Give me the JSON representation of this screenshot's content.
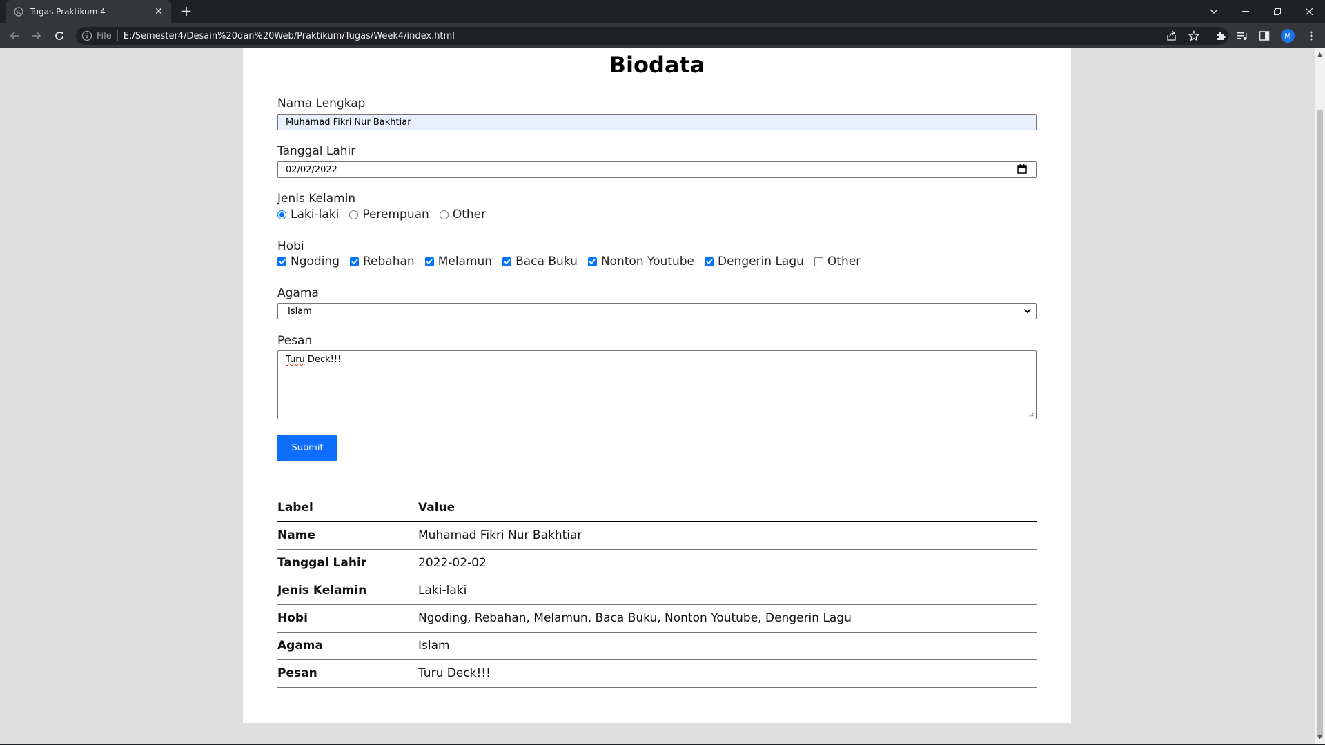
{
  "browser": {
    "tab_title": "Tugas Praktikum 4",
    "scheme": "File",
    "url": "E:/Semester4/Desain%20dan%20Web/Praktikum/Tugas/Week4/index.html",
    "profile_initial": "M"
  },
  "page": {
    "title": "Biodata",
    "form": {
      "nama_label": "Nama Lengkap",
      "nama_value": "Muhamad Fikri Nur Bakhtiar",
      "tanggal_label": "Tanggal Lahir",
      "tanggal_value": "02/02/2022",
      "gender_label": "Jenis Kelamin",
      "gender_options": [
        {
          "label": "Laki-laki",
          "checked": true
        },
        {
          "label": "Perempuan",
          "checked": false
        },
        {
          "label": "Other",
          "checked": false
        }
      ],
      "hobi_label": "Hobi",
      "hobi_options": [
        {
          "label": "Ngoding",
          "checked": true
        },
        {
          "label": "Rebahan",
          "checked": true
        },
        {
          "label": "Melamun",
          "checked": true
        },
        {
          "label": "Baca Buku",
          "checked": true
        },
        {
          "label": "Nonton Youtube",
          "checked": true
        },
        {
          "label": "Dengerin Lagu",
          "checked": true
        },
        {
          "label": "Other",
          "checked": false
        }
      ],
      "agama_label": "Agama",
      "agama_value": "Islam",
      "pesan_label": "Pesan",
      "pesan_word1": "Turu",
      "pesan_rest": " Deck!!!",
      "submit_label": "Submit"
    },
    "result_table": {
      "header_label": "Label",
      "header_value": "Value",
      "rows": [
        {
          "label": "Name",
          "value": "Muhamad Fikri Nur Bakhtiar"
        },
        {
          "label": "Tanggal Lahir",
          "value": "2022-02-02"
        },
        {
          "label": "Jenis Kelamin",
          "value": "Laki-laki"
        },
        {
          "label": "Hobi",
          "value": "Ngoding, Rebahan, Melamun, Baca Buku, Nonton Youtube, Dengerin Lagu"
        },
        {
          "label": "Agama",
          "value": "Islam"
        },
        {
          "label": "Pesan",
          "value": "Turu Deck!!!"
        }
      ]
    }
  },
  "colors": {
    "accent": "#0d6efd",
    "checkbox_blue": "#0075ff",
    "autofill_bg": "#e8f0fe",
    "page_bg": "#dedede"
  }
}
